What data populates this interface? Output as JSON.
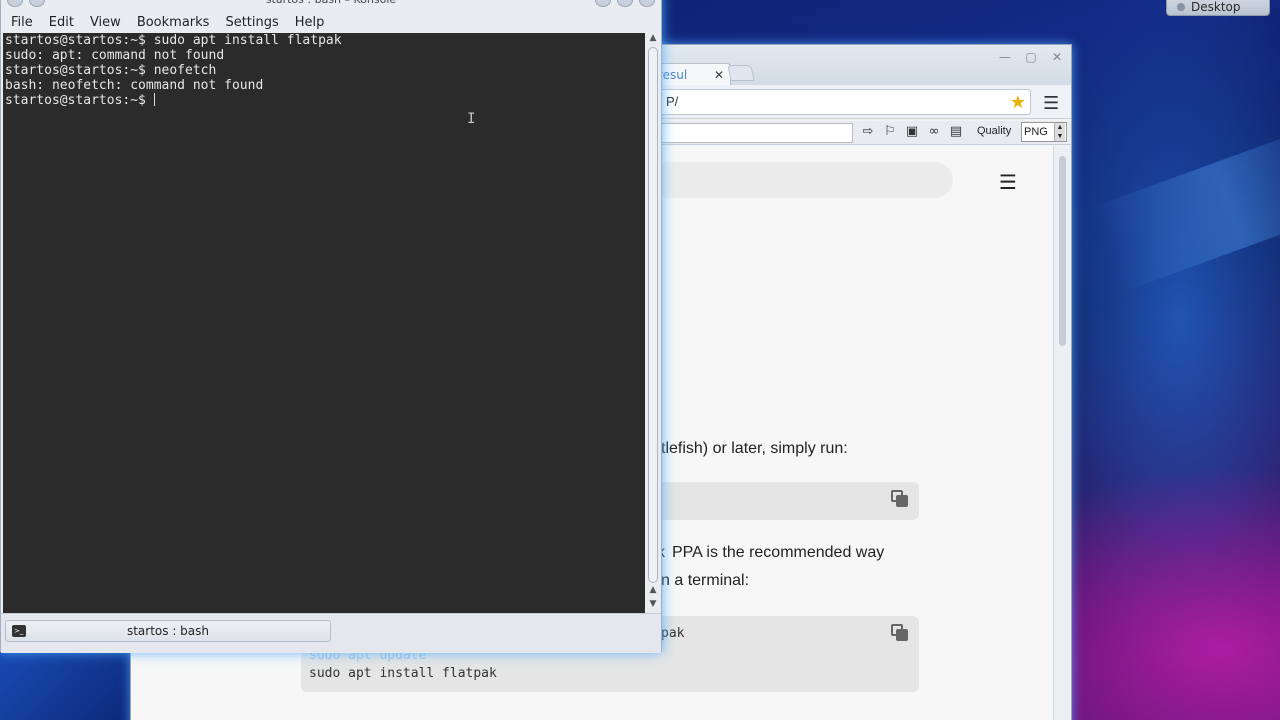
{
  "desktop": {
    "button_label": "Desktop"
  },
  "browser": {
    "tab_label": "resul",
    "tab_close": "✕",
    "url": "P/",
    "toolbar_quality": "Quality",
    "toolbar_format": "PNG",
    "page": {
      "p1": "tlefish) or later, simply run:",
      "p2": "PPA is the recommended way",
      "p2_prefix": "k",
      "p3": "n a terminal:",
      "code2_line1_partial": "pak",
      "code2_line_faded": "sudo apt update",
      "code2_line2": "sudo apt install flatpak"
    }
  },
  "konsole": {
    "title": "startos : bash – Konsole",
    "menu": [
      "File",
      "Edit",
      "View",
      "Bookmarks",
      "Settings",
      "Help"
    ],
    "lines": [
      "startos@startos:~$ sudo apt install flatpak",
      "sudo: apt: command not found",
      "startos@startos:~$ neofetch",
      "bash: neofetch: command not found",
      "startos@startos:~$ "
    ],
    "tab_label": "startos : bash"
  }
}
